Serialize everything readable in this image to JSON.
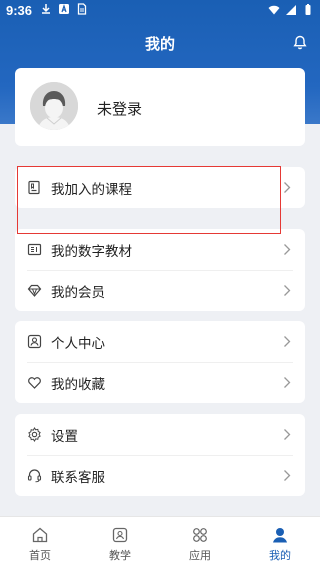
{
  "status_bar": {
    "time": "9:36"
  },
  "header": {
    "title": "我的"
  },
  "profile": {
    "login_label": "未登录"
  },
  "groups": [
    {
      "items": [
        {
          "label": "我加入的课程",
          "icon": "course-book-icon"
        }
      ]
    },
    {
      "items": [
        {
          "label": "我的数字教材",
          "icon": "digital-textbook-icon"
        },
        {
          "label": "我的会员",
          "icon": "diamond-icon"
        }
      ]
    },
    {
      "items": [
        {
          "label": "个人中心",
          "icon": "person-icon"
        },
        {
          "label": "我的收藏",
          "icon": "heart-icon"
        }
      ]
    },
    {
      "items": [
        {
          "label": "设置",
          "icon": "gear-icon"
        },
        {
          "label": "联系客服",
          "icon": "headset-icon"
        }
      ]
    }
  ],
  "tabbar": {
    "tabs": [
      {
        "label": "首页",
        "icon": "home-icon"
      },
      {
        "label": "教学",
        "icon": "teaching-icon"
      },
      {
        "label": "应用",
        "icon": "apps-icon"
      },
      {
        "label": "我的",
        "icon": "user-icon",
        "active": true
      }
    ]
  },
  "colors": {
    "primary": "#1a5fb4",
    "highlight": "#e53935",
    "background": "#eef0f4"
  }
}
